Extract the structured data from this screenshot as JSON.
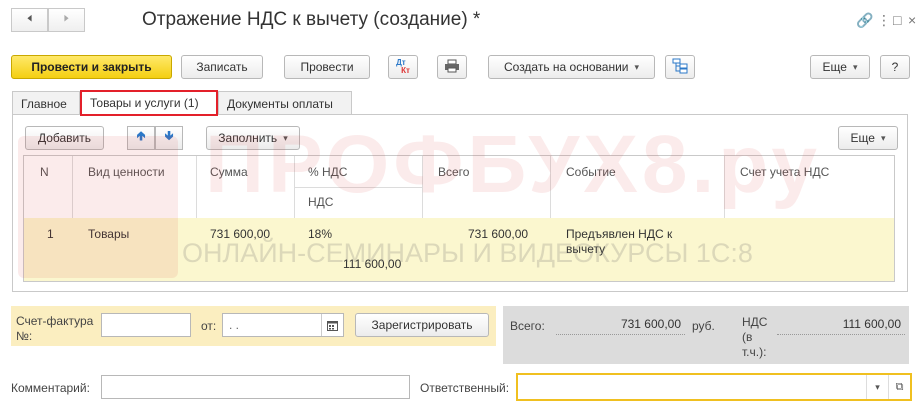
{
  "window": {
    "title": "Отражение НДС к вычету (создание) *"
  },
  "toolbar": {
    "post_close": "Провести и закрыть",
    "save": "Записать",
    "post": "Провести",
    "dt_kt_top": "Дт",
    "dt_kt_bottom": "Кт",
    "create_based_on": "Создать на основании",
    "more": "Еще",
    "help": "?"
  },
  "tabs": [
    {
      "label": "Главное"
    },
    {
      "label": "Товары и услуги (1)"
    },
    {
      "label": "Документы оплаты"
    }
  ],
  "table_toolbar": {
    "add": "Добавить",
    "fill": "Заполнить",
    "more": "Еще"
  },
  "table": {
    "headers": {
      "n": "N",
      "kind": "Вид ценности",
      "sum": "Сумма",
      "vat_pct": "% НДС",
      "vat": "НДС",
      "total": "Всего",
      "event": "Событие",
      "account": "Счет учета НДС"
    },
    "rows": [
      {
        "n": "1",
        "kind": "Товары",
        "sum": "731 600,00",
        "vat_pct": "18%",
        "vat": "111 600,00",
        "total": "731 600,00",
        "event_line1": "Предъявлен НДС к",
        "event_line2": "вычету"
      }
    ]
  },
  "watermark": {
    "brand": "ПРОФБУХ8.ру",
    "slogan": "ОНЛАЙН-СЕМИНАРЫ И ВИДЕОКУРСЫ 1С:8"
  },
  "invoice": {
    "label_line1": "Счет-фактура",
    "label_line2": "№:",
    "number_value": "",
    "from_label": "от:",
    "date_value": " .  .",
    "register_button": "Зарегистрировать"
  },
  "totals": {
    "total_label": "Всего:",
    "total_value": "731 600,00",
    "currency": "руб.",
    "vat_label_1": "НДС",
    "vat_label_2": "(в",
    "vat_label_3": "т.ч.):",
    "vat_value": "111 600,00"
  },
  "footer": {
    "comment_label": "Комментарий:",
    "comment_value": "",
    "responsible_label": "Ответственный:",
    "responsible_value": ""
  },
  "colors": {
    "primary_button": "#f4cf12",
    "active_tab_border": "#e3202a",
    "selected_row": "#fbf7cf",
    "invoice_bg": "#fbeec0",
    "totals_bg": "#dcdcdc",
    "focus_border": "#f0c020"
  }
}
